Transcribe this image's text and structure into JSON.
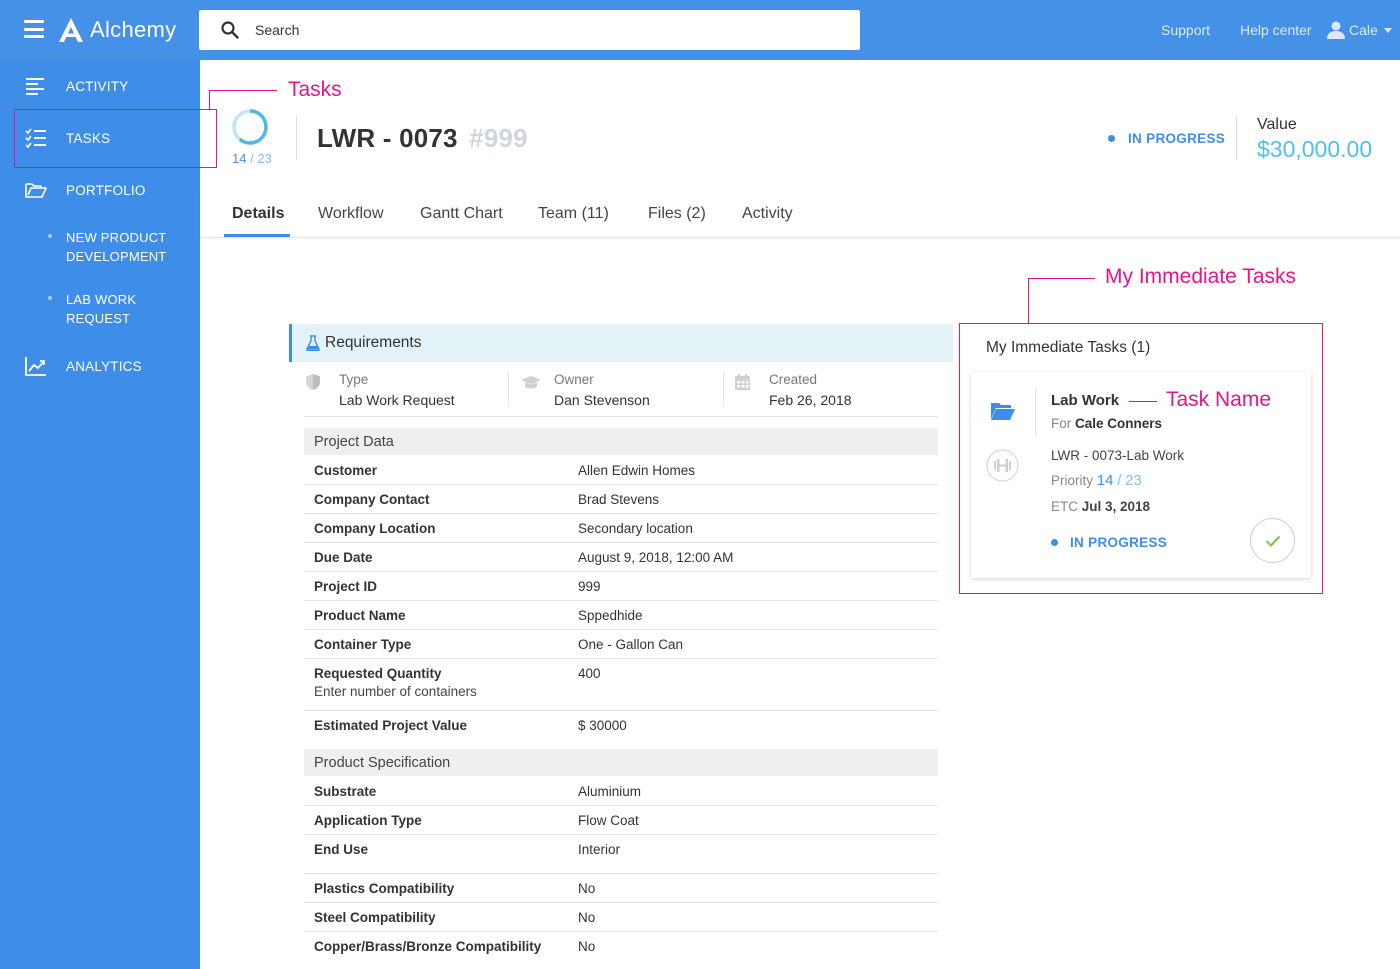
{
  "app": {
    "name": "Alchemy"
  },
  "search": {
    "placeholder": "Search"
  },
  "topnav": {
    "support": "Support",
    "help": "Help center",
    "user": "Cale"
  },
  "sidebar": {
    "items": [
      {
        "label": "ACTIVITY",
        "icon": "activity-icon"
      },
      {
        "label": "TASKS",
        "icon": "tasks-icon"
      },
      {
        "label": "PORTFOLIO",
        "icon": "folder-open-icon"
      },
      {
        "label": "NEW PRODUCT DEVELOPMENT"
      },
      {
        "label": "LAB WORK REQUEST"
      },
      {
        "label": "ANALYTICS",
        "icon": "analytics-icon"
      }
    ]
  },
  "annotations": {
    "tasks": "Tasks",
    "immediate": "My Immediate Tasks",
    "task_name": "Task Name"
  },
  "record": {
    "progress_done": "14",
    "progress_sep": "/",
    "progress_total": "23",
    "progress_fraction": 0.609,
    "title": "LWR - 0073",
    "number": "#999",
    "status": "IN PROGRESS",
    "value_label": "Value",
    "value": "$30,000.00"
  },
  "tabs": [
    "Details",
    "Workflow",
    "Gantt Chart",
    "Team (11)",
    "Files (2)",
    "Activity"
  ],
  "requirements": {
    "title": "Requirements",
    "meta": [
      {
        "label": "Type",
        "value": "Lab Work Request",
        "icon": "shield-icon"
      },
      {
        "label": "Owner",
        "value": "Dan Stevenson",
        "icon": "graduation-cap-icon"
      },
      {
        "label": "Created",
        "value": "Feb 26, 2018",
        "icon": "calendar-icon"
      }
    ],
    "project_data": {
      "title": "Project Data",
      "rows": [
        {
          "k": "Customer",
          "v": "Allen Edwin Homes"
        },
        {
          "k": "Company Contact",
          "v": "Brad Stevens"
        },
        {
          "k": "Company Location",
          "v": "Secondary location"
        },
        {
          "k": "Due Date",
          "v": "August 9, 2018, 12:00 AM"
        },
        {
          "k": "Project ID",
          "v": "999"
        },
        {
          "k": "Product Name",
          "v": "Sppedhide"
        },
        {
          "k": "Container Type",
          "v": "One - Gallon Can"
        },
        {
          "k": "Requested Quantity",
          "k2": "Enter number of containers",
          "v": "400"
        },
        {
          "k": "Estimated Project Value",
          "v": "$ 30000"
        }
      ]
    },
    "product_spec": {
      "title": "Product Specification",
      "rows": [
        {
          "k": "Substrate",
          "v": "Aluminium"
        },
        {
          "k": "Application Type",
          "v": "Flow Coat"
        },
        {
          "k": "End Use",
          "v": "Interior"
        },
        {
          "k": "Plastics Compatibility",
          "v": "No"
        },
        {
          "k": "Steel Compatibility",
          "v": "No"
        },
        {
          "k": "Copper/Brass/Bronze Compatibility",
          "v": "No"
        }
      ]
    }
  },
  "immediate_tasks": {
    "title": "My Immediate Tasks (1)",
    "task": {
      "name": "Lab Work",
      "for_label": "For",
      "for_name": "Cale Conners",
      "ref": "LWR - 0073-Lab Work",
      "priority_label": "Priority",
      "priority": "14",
      "priority_sep": "/",
      "priority_total": "23",
      "etc_label": "ETC",
      "etc": "Jul 3, 2018",
      "status": "IN PROGRESS"
    }
  },
  "colors": {
    "primary": "#3e8ee9",
    "topbar": "#4691e8",
    "value": "#4fc0e8",
    "annotation": "#e2168c",
    "check": "#8cc152"
  }
}
